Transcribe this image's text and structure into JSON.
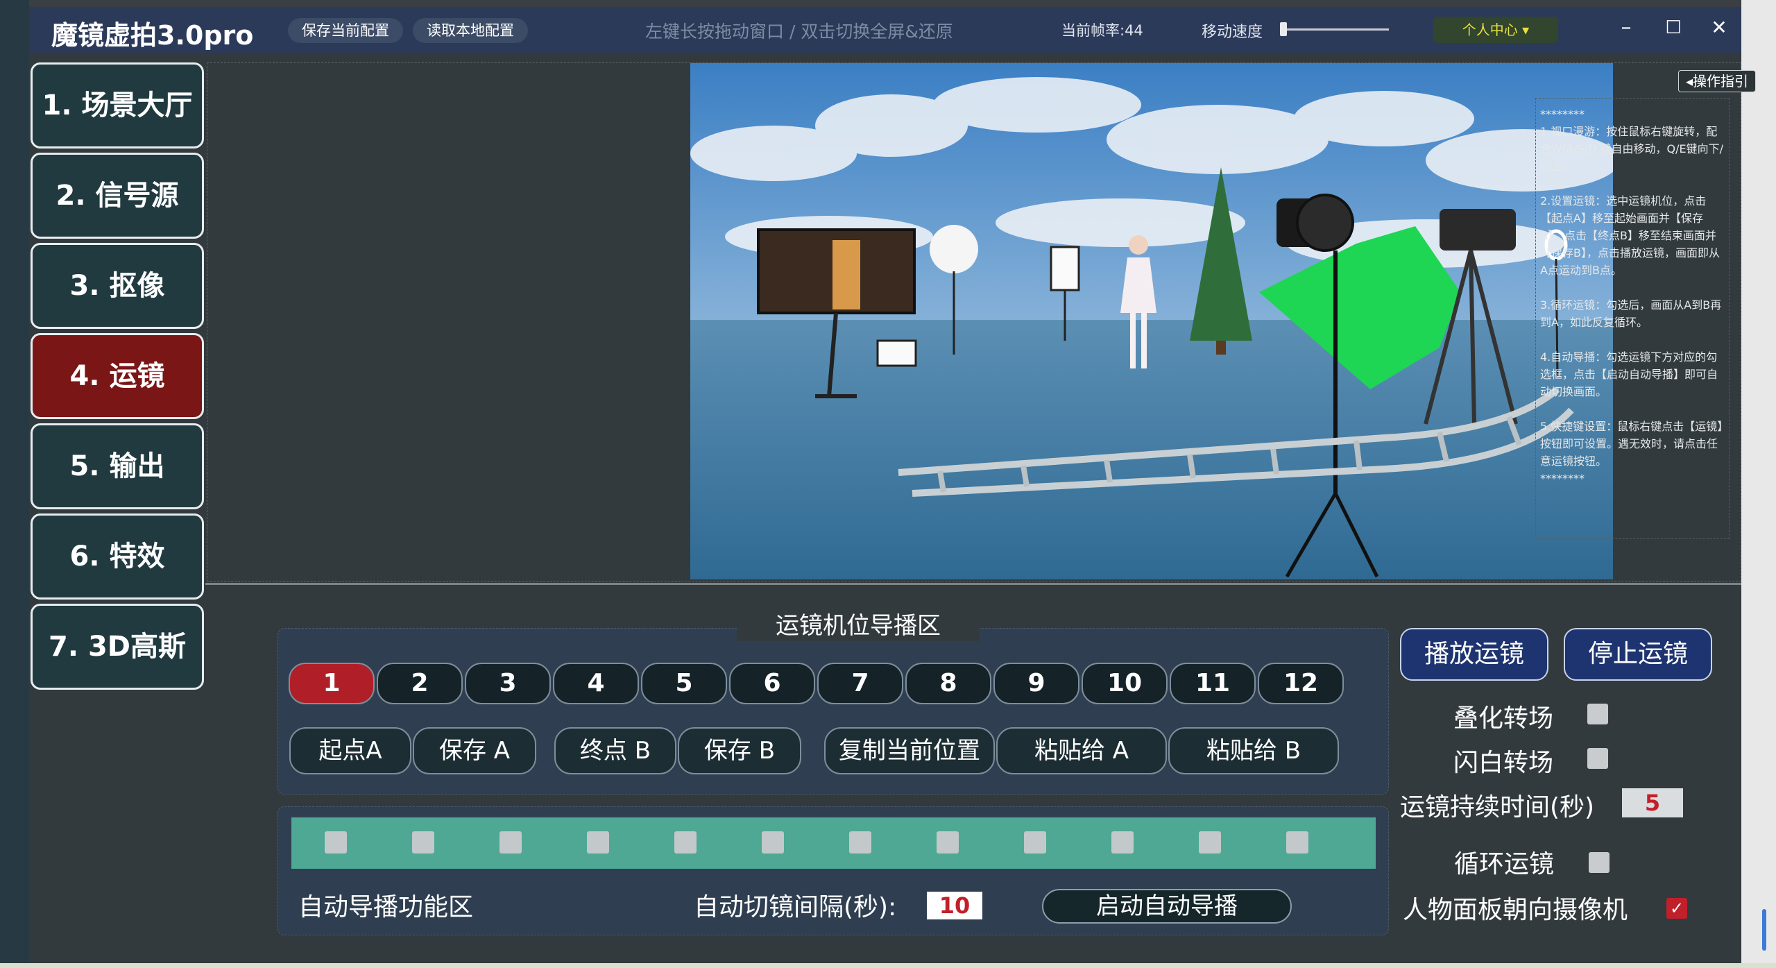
{
  "titlebar": {
    "app_title": "魔镜虚拍3.0pro",
    "save_config": "保存当前配置",
    "load_config": "读取本地配置",
    "drag_hint": "左键长按拖动窗口 / 双击切换全屏&还原",
    "fps_text": "当前帧率:44",
    "speed_label": "移动速度",
    "speed_value": 0.02,
    "user_center": "个人中心 ▾",
    "minimize": "–",
    "maximize": "☐",
    "close": "✕"
  },
  "sidebar": {
    "items": [
      {
        "label": "1. 场景大厅",
        "active": false
      },
      {
        "label": "2. 信号源",
        "active": false
      },
      {
        "label": "3. 抠像",
        "active": false
      },
      {
        "label": "4. 运镜",
        "active": true
      },
      {
        "label": "5. 输出",
        "active": false
      },
      {
        "label": "6. 特效",
        "active": false
      },
      {
        "label": "7. 3D高斯",
        "active": false
      }
    ]
  },
  "guide": {
    "button": "◂操作指引",
    "stars": "********",
    "items": [
      "1.视口漫游：按住鼠标右键旋转，配合W/A/S/D 键自由移动，Q/E键向下/向上。",
      "2.设置运镜：选中运镜机位，点击【起点A】移至起始画面并【保存A】，点击【终点B】移至结束画面并【保存B】，点击播放运镜，画面即从A点运动到B点。",
      "3.循环运镜：勾选后，画面从A到B再到A，如此反复循环。",
      "4.自动导播：勾选运镜下方对应的勾选框，点击【启动自动导播】即可自动切换画面。",
      "5.快捷键设置：鼠标右键点击【运镜】按钮即可设置。遇无效时，请点击任意运镜按钮。"
    ]
  },
  "director": {
    "title": "运镜机位导播区",
    "positions": [
      "1",
      "2",
      "3",
      "4",
      "5",
      "6",
      "7",
      "8",
      "9",
      "10",
      "11",
      "12"
    ],
    "active_position": 0,
    "start_a": "起点A",
    "save_a": "保存 A",
    "end_b": "终点 B",
    "save_b": "保存 B",
    "copy_position": "复制当前位置",
    "paste_a": "粘贴给 A",
    "paste_b": "粘贴给 B"
  },
  "auto": {
    "label": "自动导播功能区",
    "interval_label": "自动切镜间隔(秒):",
    "interval_value": "10",
    "start_button": "启动自动导播",
    "checkboxes": [
      false,
      false,
      false,
      false,
      false,
      false,
      false,
      false,
      false,
      false,
      false,
      false
    ]
  },
  "controls": {
    "play": "播放运镜",
    "stop": "停止运镜",
    "crossfade_label": "叠化转场",
    "crossfade_checked": false,
    "flash_label": "闪白转场",
    "flash_checked": false,
    "duration_label": "运镜持续时间(秒)",
    "duration_value": "5",
    "loop_label": "循环运镜",
    "loop_checked": false,
    "face_camera_label": "人物面板朝向摄像机",
    "face_camera_checked": true,
    "check_mark": "✓"
  },
  "colors": {
    "titlebar": "#2c3a5a",
    "active_red": "#b01f27",
    "sidebar_active": "#7a1616",
    "accent_yellow": "#e8e042",
    "auto_bar": "#4ea893"
  }
}
